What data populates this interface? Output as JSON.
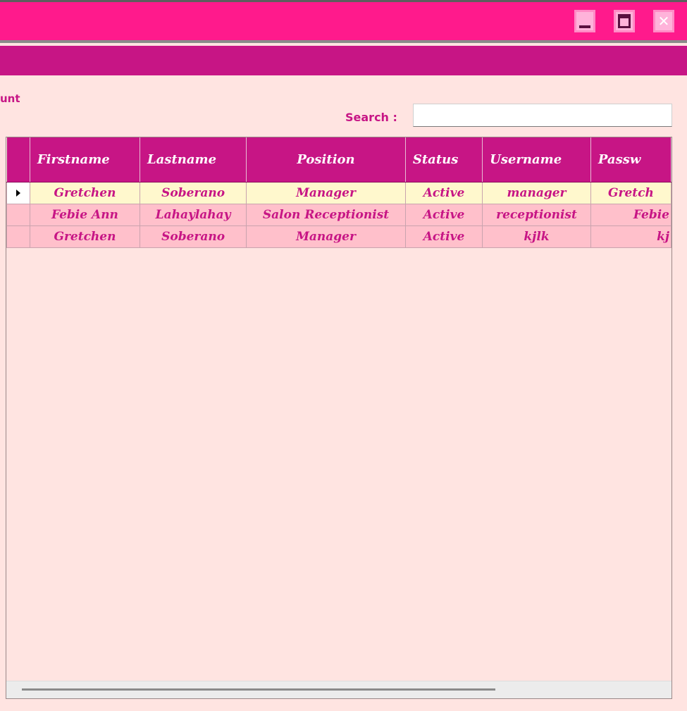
{
  "window": {
    "controls": {
      "minimize_icon": "minimize-icon",
      "maximize_icon": "maximize-icon",
      "close_icon": "close-icon",
      "close_glyph": "✕"
    },
    "colors": {
      "titlebar": "#ff1a8c",
      "ribbon": "#c71585",
      "background": "#ffe4e1",
      "accent_text": "#c71585"
    }
  },
  "section": {
    "label": "unt"
  },
  "search": {
    "label": "Search :",
    "value": "",
    "placeholder": ""
  },
  "table": {
    "columns": [
      "",
      "Firstname",
      "Lastname",
      "Position",
      "Status",
      "Username",
      "Passw"
    ],
    "rows": [
      {
        "selected": true,
        "cells": [
          "Gretchen",
          "Soberano",
          "Manager",
          "Active",
          "manager",
          "Gretch"
        ]
      },
      {
        "selected": false,
        "cells": [
          "Febie Ann",
          "Lahaylahay",
          "Salon Receptionist",
          "Active",
          "receptionist",
          "Febie"
        ]
      },
      {
        "selected": false,
        "cells": [
          "Gretchen",
          "Soberano",
          "Manager",
          "Active",
          "kjlk",
          "kj"
        ]
      }
    ],
    "row_colors": {
      "selected": "#fff8cd",
      "normal": "#ffc0cb"
    },
    "horizontal_scroll_fraction": 0.0
  }
}
